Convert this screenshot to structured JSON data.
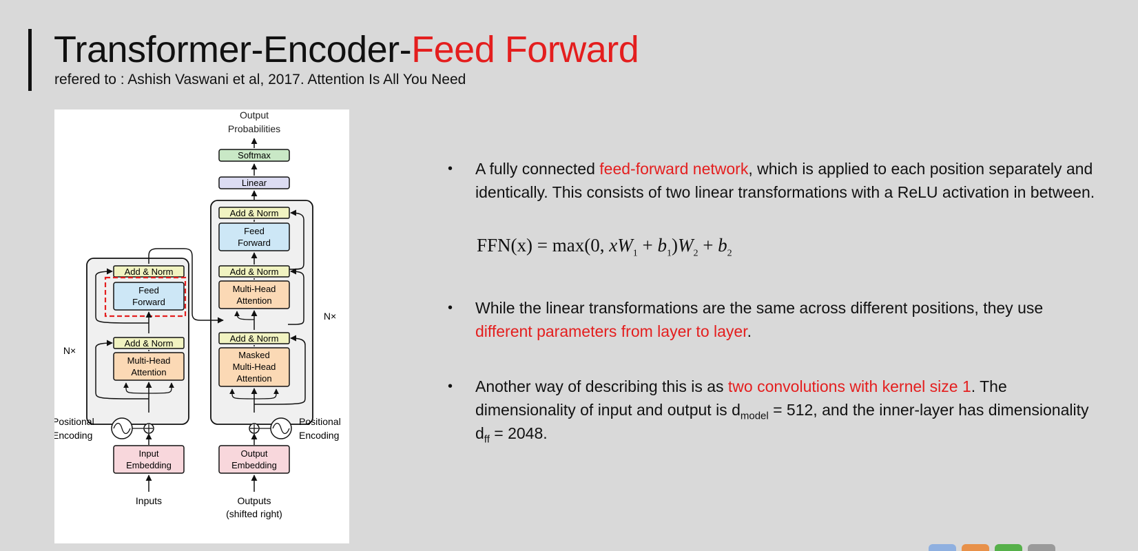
{
  "slide": {
    "title_main": "Transformer-Encoder-",
    "title_highlight": "Feed Forward",
    "subtitle": "refered to : Ashish Vaswani et al, 2017. Attention Is All You Need"
  },
  "diagram": {
    "output_probabilities": [
      "Output",
      "Probabilities"
    ],
    "softmax": "Softmax",
    "linear": "Linear",
    "add_norm": "Add & Norm",
    "feed_forward": [
      "Feed",
      "Forward"
    ],
    "multi_head_attention": [
      "Multi-Head",
      "Attention"
    ],
    "masked_multi_head_attention": [
      "Masked",
      "Multi-Head",
      "Attention"
    ],
    "n_times": "N×",
    "positional_encoding": [
      "Positional",
      "Encoding"
    ],
    "input_embedding": [
      "Input",
      "Embedding"
    ],
    "output_embedding": [
      "Output",
      "Embedding"
    ],
    "inputs": "Inputs",
    "outputs": [
      "Outputs",
      "(shifted right)"
    ],
    "colors": {
      "ffn": "#cde7f6",
      "attention": "#fbd9b5",
      "addnorm": "#f1f3c1",
      "embed": "#f8d7dc",
      "softmax": "#c9e8c6",
      "linear": "#dcdcf2",
      "highlight": "#e41e1e"
    }
  },
  "bullets": {
    "b1_before": "A fully connected ",
    "b1_red": "feed-forward network",
    "b1_after": ", which is applied to each position separately and identically. This consists of two linear transformations with a ReLU activation in between.",
    "formula_left": "FFN(x) = max(0, ",
    "formula_xw": "xW",
    "formula_sub1": "1",
    "formula_plus1": " + ",
    "formula_b": "b",
    "formula_sub_b1": "1",
    "formula_mid": ")",
    "formula_w2": "W",
    "formula_sub2": "2",
    "formula_plus2": " + ",
    "formula_b2": "b",
    "formula_sub_b2": "2",
    "b2_before": "While the linear transformations are the same across different positions, they use ",
    "b2_red": "different parameters from layer to layer",
    "b2_after": ".",
    "b3_before": "Another way of describing this is as ",
    "b3_red": "two convolutions with kernel size 1",
    "b3_after": ". The dimensionality of input and output is d",
    "b3_sub_model": "model",
    "b3_mid": " = 512, and the inner-layer has dimensionality d",
    "b3_sub_ff": "ff",
    "b3_end": " = 2048."
  },
  "corner_icon_colors": [
    "#8fb0e0",
    "#e8914a",
    "#56b04a",
    "#9a9a9a"
  ]
}
